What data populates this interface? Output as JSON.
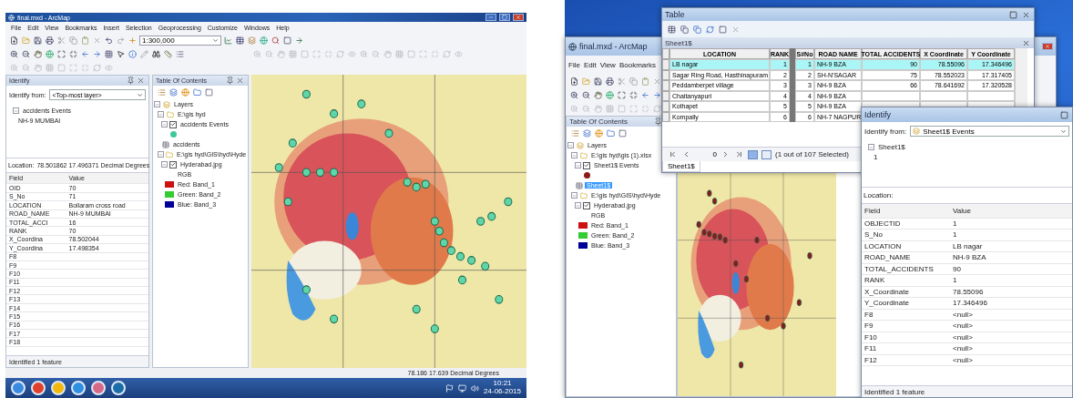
{
  "left": {
    "title": "final.mxd - ArcMap",
    "menu": [
      "File",
      "Edit",
      "View",
      "Bookmarks",
      "Insert",
      "Selection",
      "Geoprocessing",
      "Customize",
      "Windows",
      "Help"
    ],
    "scale": "1:300,000",
    "identify": {
      "title": "Identify",
      "from_label": "Identify from:",
      "from_value": "<Top-most layer>",
      "tree": [
        {
          "label": "accidents Events",
          "expanded": true,
          "selected": false,
          "children": [
            {
              "label": "NH-9 MUMBAI",
              "selected": false
            }
          ]
        }
      ],
      "location_label": "Location:",
      "location_value": "78.501862  17.496371 Decimal Degrees",
      "columns": [
        "Field",
        "Value"
      ],
      "rows": [
        {
          "field": "OID",
          "value": "70"
        },
        {
          "field": "S_No",
          "value": "71"
        },
        {
          "field": "LOCATION",
          "value": "Bollaram cross road"
        },
        {
          "field": "ROAD_NAME",
          "value": "NH-9 MUMBAI"
        },
        {
          "field": "TOTAL_ACCI",
          "value": "16"
        },
        {
          "field": "RANK",
          "value": "70"
        },
        {
          "field": "X_Coordina",
          "value": "78.502044"
        },
        {
          "field": "Y_Coordina",
          "value": "17.498354"
        },
        {
          "field": "F8"
        },
        {
          "field": "F9"
        },
        {
          "field": "F10"
        },
        {
          "field": "F11"
        },
        {
          "field": "F12"
        },
        {
          "field": "F13"
        },
        {
          "field": "F14"
        },
        {
          "field": "F15"
        },
        {
          "field": "F16"
        },
        {
          "field": "F17"
        },
        {
          "field": "F18"
        }
      ],
      "status": "Identified 1 feature"
    },
    "toc": {
      "title": "Table Of Contents",
      "tree": [
        {
          "label": "Layers",
          "kind": "root",
          "expanded": true,
          "selected": false,
          "children": [
            {
              "label": "E:\\gis hyd",
              "kind": "folder",
              "expanded": true,
              "selected": false,
              "children": [
                {
                  "label": "accidents Events",
                  "kind": "layer",
                  "checked": true,
                  "expanded": true,
                  "selected": false,
                  "children": [
                    {
                      "kind": "symbol",
                      "color": "#3cc99a"
                    }
                  ]
                },
                {
                  "label": "accidents",
                  "kind": "table",
                  "selected": false
                }
              ]
            },
            {
              "label": "E:\\gis hyd\\GIS\\hyd\\Hyde",
              "kind": "folder",
              "expanded": true,
              "selected": false,
              "children": [
                {
                  "label": "Hyderabad.jpg",
                  "kind": "layer",
                  "checked": true,
                  "expanded": true,
                  "selected": false,
                  "children": [
                    {
                      "label": "RGB",
                      "kind": "text",
                      "selected": false
                    },
                    {
                      "label": "Red:   Band_1",
                      "kind": "band",
                      "color": "#cc1111",
                      "selected": false
                    },
                    {
                      "label": "Green: Band_2",
                      "kind": "band",
                      "color": "#33cc33",
                      "selected": false
                    },
                    {
                      "label": "Blue:  Band_3",
                      "kind": "band",
                      "color": "#000099",
                      "selected": false
                    }
                  ]
                }
              ]
            }
          ]
        }
      ]
    },
    "coordinates": "78.186  17.639 Decimal Degrees",
    "taskbar": {
      "time": "10:21",
      "date": "24-06-2015"
    }
  },
  "right": {
    "arcmap": {
      "title": "final.mxd - ArcMap",
      "menu": [
        "File",
        "Edit",
        "View",
        "Bookmarks"
      ],
      "toc": {
        "title": "Table Of Contents",
        "tree": [
          {
            "label": "Layers",
            "kind": "root",
            "expanded": true,
            "selected": false,
            "children": [
              {
                "label": "E:\\gis hyd\\gis (1).xlsx",
                "kind": "folder",
                "expanded": true,
                "selected": false,
                "children": [
                  {
                    "label": "Sheet1$ Events",
                    "kind": "layer",
                    "checked": true,
                    "expanded": true,
                    "selected": false,
                    "children": [
                      {
                        "kind": "symbol",
                        "color": "#8b1a1a"
                      }
                    ]
                  },
                  {
                    "label": "Sheet1$",
                    "kind": "table",
                    "selected": true
                  }
                ]
              },
              {
                "label": "E:\\gis hyd\\GIS\\hyd\\Hyde",
                "kind": "folder",
                "expanded": true,
                "selected": false,
                "children": [
                  {
                    "label": "Hyderabad.jpg",
                    "kind": "layer",
                    "checked": true,
                    "expanded": true,
                    "selected": false,
                    "children": [
                      {
                        "label": "RGB",
                        "kind": "text",
                        "selected": false
                      },
                      {
                        "label": "Red:   Band_1",
                        "kind": "band",
                        "color": "#cc1111",
                        "selected": false
                      },
                      {
                        "label": "Green: Band_2",
                        "kind": "band",
                        "color": "#33cc33",
                        "selected": false
                      },
                      {
                        "label": "Blue:  Band_3",
                        "kind": "band",
                        "color": "#000099",
                        "selected": false
                      }
                    ]
                  }
                ]
              }
            ]
          }
        ]
      }
    },
    "table": {
      "title": "Table",
      "sheet_title": "Sheet1$",
      "columns": [
        "LOCATION",
        "RANK",
        "S#No",
        "ROAD NAME",
        "TOTAL ACCIDENTS",
        "X Coordinate",
        "Y Coordinate"
      ],
      "rows": [
        {
          "selected": true,
          "cells": [
            "LB nagar",
            "1",
            "1",
            "NH-9 BZA",
            "90",
            "78.55096",
            "17.346496"
          ]
        },
        {
          "selected": false,
          "cells": [
            "Sagar Ring Road, Hasthinapuram",
            "2",
            "2",
            "SH-N'SAGAR",
            "75",
            "78.552023",
            "17.317405"
          ]
        },
        {
          "selected": false,
          "cells": [
            "Peddamberpet village",
            "3",
            "3",
            "NH-9 BZA",
            "66",
            "78.641692",
            "17.320528"
          ]
        },
        {
          "selected": false,
          "cells": [
            "Chaitanyapuri",
            "4",
            "4",
            "NH-9 BZA"
          ]
        },
        {
          "selected": false,
          "cells": [
            "Kothapet",
            "5",
            "5",
            "NH-9 BZA"
          ]
        },
        {
          "selected": false,
          "cells": [
            "Kompally",
            "6",
            "6",
            "NH-7 NAGPUR"
          ]
        }
      ],
      "record": "0",
      "views": [
        {
          "selected": true
        },
        {
          "selected": false
        }
      ],
      "selection_text": "(1 out of 107 Selected)",
      "tab": "Sheet1$"
    },
    "identify": {
      "title": "Identify",
      "from_label": "Identify from:",
      "from_value": "Sheet1$ Events",
      "tree": [
        {
          "label": "Sheet1$",
          "expanded": true,
          "selected": false,
          "children": [
            {
              "label": "1",
              "selected": false
            }
          ]
        }
      ],
      "location_label": "Location:",
      "columns": [
        "Field",
        "Value"
      ],
      "rows": [
        {
          "field": "OBJECTID",
          "value": "1"
        },
        {
          "field": "S_No",
          "value": "1"
        },
        {
          "field": "LOCATION",
          "value": "LB nagar"
        },
        {
          "field": "ROAD_NAME",
          "value": "NH-9 BZA"
        },
        {
          "field": "TOTAL_ACCIDENTS",
          "value": "90"
        },
        {
          "field": "RANK",
          "value": "1"
        },
        {
          "field": "X_Coordinate",
          "value": "78.55096"
        },
        {
          "field": "Y_Coordinate",
          "value": "17.346496"
        },
        {
          "field": "F8",
          "value": "<null>"
        },
        {
          "field": "F9",
          "value": "<null>"
        },
        {
          "field": "F10",
          "value": "<null>"
        },
        {
          "field": "F11",
          "value": "<null>"
        },
        {
          "field": "F12",
          "value": "<null>"
        }
      ],
      "status": "Identified 1 feature"
    }
  }
}
